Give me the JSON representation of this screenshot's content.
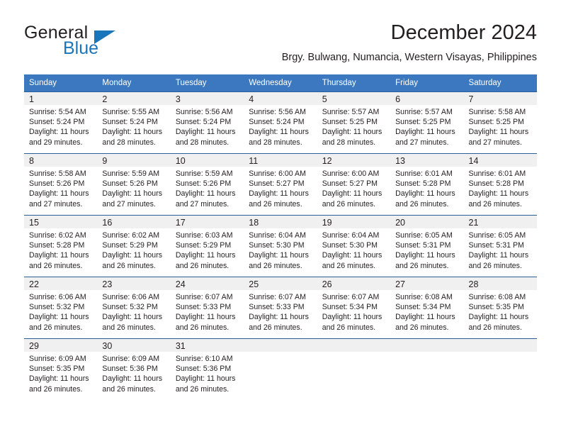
{
  "brand": {
    "name_top": "General",
    "name_bottom": "Blue",
    "accent_color": "#1b75bb"
  },
  "header": {
    "title": "December 2024",
    "subtitle": "Brgy. Bulwang, Numancia, Western Visayas, Philippines"
  },
  "theme": {
    "header_bg": "#3b78bf",
    "row_divider": "#2a6099",
    "daynum_bg": "#f0f0f0",
    "text": "#231f20"
  },
  "calendar": {
    "weekday_headers": [
      "Sunday",
      "Monday",
      "Tuesday",
      "Wednesday",
      "Thursday",
      "Friday",
      "Saturday"
    ],
    "weeks": [
      [
        {
          "day": "1",
          "sunrise": "Sunrise: 5:54 AM",
          "sunset": "Sunset: 5:24 PM",
          "daylight": "Daylight: 11 hours and 29 minutes."
        },
        {
          "day": "2",
          "sunrise": "Sunrise: 5:55 AM",
          "sunset": "Sunset: 5:24 PM",
          "daylight": "Daylight: 11 hours and 28 minutes."
        },
        {
          "day": "3",
          "sunrise": "Sunrise: 5:56 AM",
          "sunset": "Sunset: 5:24 PM",
          "daylight": "Daylight: 11 hours and 28 minutes."
        },
        {
          "day": "4",
          "sunrise": "Sunrise: 5:56 AM",
          "sunset": "Sunset: 5:24 PM",
          "daylight": "Daylight: 11 hours and 28 minutes."
        },
        {
          "day": "5",
          "sunrise": "Sunrise: 5:57 AM",
          "sunset": "Sunset: 5:25 PM",
          "daylight": "Daylight: 11 hours and 28 minutes."
        },
        {
          "day": "6",
          "sunrise": "Sunrise: 5:57 AM",
          "sunset": "Sunset: 5:25 PM",
          "daylight": "Daylight: 11 hours and 27 minutes."
        },
        {
          "day": "7",
          "sunrise": "Sunrise: 5:58 AM",
          "sunset": "Sunset: 5:25 PM",
          "daylight": "Daylight: 11 hours and 27 minutes."
        }
      ],
      [
        {
          "day": "8",
          "sunrise": "Sunrise: 5:58 AM",
          "sunset": "Sunset: 5:26 PM",
          "daylight": "Daylight: 11 hours and 27 minutes."
        },
        {
          "day": "9",
          "sunrise": "Sunrise: 5:59 AM",
          "sunset": "Sunset: 5:26 PM",
          "daylight": "Daylight: 11 hours and 27 minutes."
        },
        {
          "day": "10",
          "sunrise": "Sunrise: 5:59 AM",
          "sunset": "Sunset: 5:26 PM",
          "daylight": "Daylight: 11 hours and 27 minutes."
        },
        {
          "day": "11",
          "sunrise": "Sunrise: 6:00 AM",
          "sunset": "Sunset: 5:27 PM",
          "daylight": "Daylight: 11 hours and 26 minutes."
        },
        {
          "day": "12",
          "sunrise": "Sunrise: 6:00 AM",
          "sunset": "Sunset: 5:27 PM",
          "daylight": "Daylight: 11 hours and 26 minutes."
        },
        {
          "day": "13",
          "sunrise": "Sunrise: 6:01 AM",
          "sunset": "Sunset: 5:28 PM",
          "daylight": "Daylight: 11 hours and 26 minutes."
        },
        {
          "day": "14",
          "sunrise": "Sunrise: 6:01 AM",
          "sunset": "Sunset: 5:28 PM",
          "daylight": "Daylight: 11 hours and 26 minutes."
        }
      ],
      [
        {
          "day": "15",
          "sunrise": "Sunrise: 6:02 AM",
          "sunset": "Sunset: 5:28 PM",
          "daylight": "Daylight: 11 hours and 26 minutes."
        },
        {
          "day": "16",
          "sunrise": "Sunrise: 6:02 AM",
          "sunset": "Sunset: 5:29 PM",
          "daylight": "Daylight: 11 hours and 26 minutes."
        },
        {
          "day": "17",
          "sunrise": "Sunrise: 6:03 AM",
          "sunset": "Sunset: 5:29 PM",
          "daylight": "Daylight: 11 hours and 26 minutes."
        },
        {
          "day": "18",
          "sunrise": "Sunrise: 6:04 AM",
          "sunset": "Sunset: 5:30 PM",
          "daylight": "Daylight: 11 hours and 26 minutes."
        },
        {
          "day": "19",
          "sunrise": "Sunrise: 6:04 AM",
          "sunset": "Sunset: 5:30 PM",
          "daylight": "Daylight: 11 hours and 26 minutes."
        },
        {
          "day": "20",
          "sunrise": "Sunrise: 6:05 AM",
          "sunset": "Sunset: 5:31 PM",
          "daylight": "Daylight: 11 hours and 26 minutes."
        },
        {
          "day": "21",
          "sunrise": "Sunrise: 6:05 AM",
          "sunset": "Sunset: 5:31 PM",
          "daylight": "Daylight: 11 hours and 26 minutes."
        }
      ],
      [
        {
          "day": "22",
          "sunrise": "Sunrise: 6:06 AM",
          "sunset": "Sunset: 5:32 PM",
          "daylight": "Daylight: 11 hours and 26 minutes."
        },
        {
          "day": "23",
          "sunrise": "Sunrise: 6:06 AM",
          "sunset": "Sunset: 5:32 PM",
          "daylight": "Daylight: 11 hours and 26 minutes."
        },
        {
          "day": "24",
          "sunrise": "Sunrise: 6:07 AM",
          "sunset": "Sunset: 5:33 PM",
          "daylight": "Daylight: 11 hours and 26 minutes."
        },
        {
          "day": "25",
          "sunrise": "Sunrise: 6:07 AM",
          "sunset": "Sunset: 5:33 PM",
          "daylight": "Daylight: 11 hours and 26 minutes."
        },
        {
          "day": "26",
          "sunrise": "Sunrise: 6:07 AM",
          "sunset": "Sunset: 5:34 PM",
          "daylight": "Daylight: 11 hours and 26 minutes."
        },
        {
          "day": "27",
          "sunrise": "Sunrise: 6:08 AM",
          "sunset": "Sunset: 5:34 PM",
          "daylight": "Daylight: 11 hours and 26 minutes."
        },
        {
          "day": "28",
          "sunrise": "Sunrise: 6:08 AM",
          "sunset": "Sunset: 5:35 PM",
          "daylight": "Daylight: 11 hours and 26 minutes."
        }
      ],
      [
        {
          "day": "29",
          "sunrise": "Sunrise: 6:09 AM",
          "sunset": "Sunset: 5:35 PM",
          "daylight": "Daylight: 11 hours and 26 minutes."
        },
        {
          "day": "30",
          "sunrise": "Sunrise: 6:09 AM",
          "sunset": "Sunset: 5:36 PM",
          "daylight": "Daylight: 11 hours and 26 minutes."
        },
        {
          "day": "31",
          "sunrise": "Sunrise: 6:10 AM",
          "sunset": "Sunset: 5:36 PM",
          "daylight": "Daylight: 11 hours and 26 minutes."
        },
        {
          "day": "",
          "sunrise": "",
          "sunset": "",
          "daylight": ""
        },
        {
          "day": "",
          "sunrise": "",
          "sunset": "",
          "daylight": ""
        },
        {
          "day": "",
          "sunrise": "",
          "sunset": "",
          "daylight": ""
        },
        {
          "day": "",
          "sunrise": "",
          "sunset": "",
          "daylight": ""
        }
      ]
    ]
  }
}
